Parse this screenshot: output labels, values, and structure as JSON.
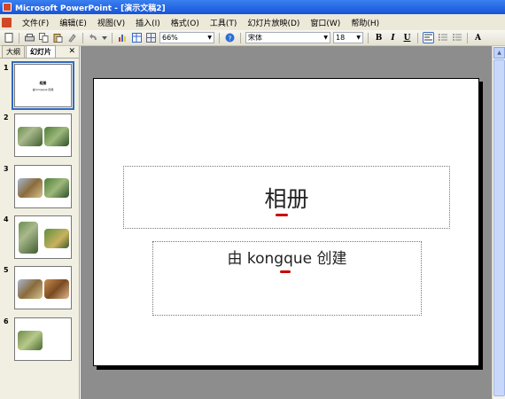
{
  "window": {
    "title": "Microsoft PowerPoint - [演示文稿2]"
  },
  "menu": [
    "文件(F)",
    "编辑(E)",
    "视图(V)",
    "插入(I)",
    "格式(O)",
    "工具(T)",
    "幻灯片放映(D)",
    "窗口(W)",
    "帮助(H)"
  ],
  "toolbar": {
    "zoom": "66%",
    "font": "宋体",
    "font_size": "18",
    "bold": "B",
    "italic": "I",
    "underline": "U",
    "grow_font": "A"
  },
  "left_pane": {
    "tabs": [
      "大纲",
      "幻灯片"
    ],
    "close": "✕",
    "slides": [
      {
        "num": "1",
        "title": "相册",
        "subtitle": "由 kongque 创建"
      },
      {
        "num": "2"
      },
      {
        "num": "3"
      },
      {
        "num": "4"
      },
      {
        "num": "5"
      },
      {
        "num": "6"
      }
    ]
  },
  "slide": {
    "title": "相册",
    "subtitle": "由 kongque 创建"
  },
  "colors": {
    "titlebar": "#1754d8",
    "menubar": "#ece9d8",
    "editarea": "#8d8d8d",
    "annotation": "#cc0000"
  }
}
